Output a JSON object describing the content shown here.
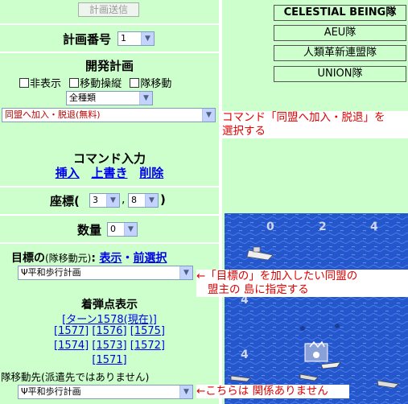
{
  "top_button": "計画送信",
  "plan_number": {
    "label": "計画番号",
    "value": "1"
  },
  "development_plan": {
    "title": "開発計画",
    "checkboxes": [
      "非表示",
      "移動操縦",
      "隊移動"
    ],
    "category_value": "全種類",
    "command_value": "同盟へ加入・脱退(無料)"
  },
  "command_input": {
    "title": "コマンド入力",
    "insert": "挿入",
    "overwrite": "上書き",
    "delete": "削除"
  },
  "coords": {
    "label": "座標(",
    "x": "3",
    "comma": ",",
    "y": "8",
    "close": ")"
  },
  "quantity": {
    "label": "数量",
    "value": "0"
  },
  "target": {
    "label": "目標の",
    "sub": "(隊移動元)",
    "colon": ":",
    "show": "表示",
    "dot": "・",
    "prev": "前選択",
    "value": "Ψ平和歩行計画"
  },
  "impact": {
    "title": "着弾点表示",
    "current": "[ターン1578(現在)]",
    "turns": [
      "[1577]",
      "[1576]",
      "[1575]",
      "[1574]",
      "[1573]",
      "[1572]",
      "[1571]"
    ]
  },
  "destination": {
    "label": "隊移動先(派遣先ではありません)",
    "value": "Ψ平和歩行計画"
  },
  "teams": [
    "CELESTIAL BEING隊",
    "AEU隊",
    "人類革新連盟隊",
    "UNION隊"
  ],
  "annotations": {
    "command_note_1": "コマンド「同盟へ加入・脱退」を",
    "command_note_2": "選択する",
    "target_note_1": "←「目標の」を加入したい同盟の",
    "target_note_2": "盟主の 島に指定する",
    "dest_note": "←こちらは 関係ありません"
  },
  "map": {
    "labels": [
      "0",
      "2",
      "4",
      "4",
      "4"
    ]
  },
  "colors": {
    "panel_bg": "#ccffcc",
    "sea": "#2a5bd0",
    "annotation_red": "#e00000",
    "link": "#0000ee"
  }
}
